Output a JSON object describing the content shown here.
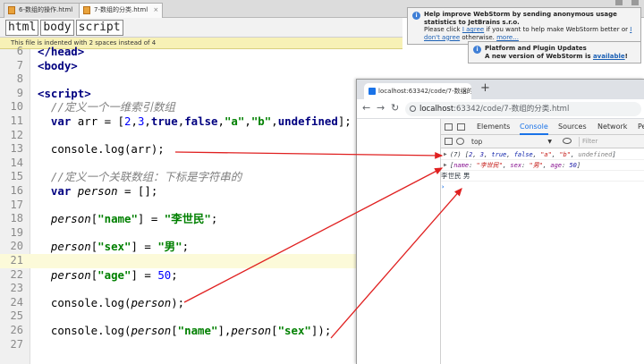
{
  "tabs": [
    {
      "label": "6-数组的操作.html",
      "active": false
    },
    {
      "label": "7-数组的分类.html",
      "active": true
    }
  ],
  "breadcrumb": [
    "html",
    "body",
    "script"
  ],
  "indent_warning": "This file is indented with 2 spaces instead of 4",
  "code_lines": [
    {
      "num": "6",
      "text": "</head>"
    },
    {
      "num": "7",
      "text": "<body>"
    },
    {
      "num": "8",
      "text": ""
    },
    {
      "num": "9",
      "text": "<script>"
    },
    {
      "num": "10",
      "text": "  //定义一个一维索引数组"
    },
    {
      "num": "11",
      "text": "  var arr = [2,3,true,false,\"a\",\"b\",undefined];"
    },
    {
      "num": "12",
      "text": ""
    },
    {
      "num": "13",
      "text": "  console.log(arr);"
    },
    {
      "num": "14",
      "text": ""
    },
    {
      "num": "15",
      "text": "  //定义一个关联数组：下标是字符串的"
    },
    {
      "num": "16",
      "text": "  var person = [];"
    },
    {
      "num": "17",
      "text": ""
    },
    {
      "num": "18",
      "text": "  person[\"name\"] = \"李世民\";"
    },
    {
      "num": "19",
      "text": ""
    },
    {
      "num": "20",
      "text": "  person[\"sex\"] = \"男\";"
    },
    {
      "num": "21",
      "text": ""
    },
    {
      "num": "22",
      "text": "  person[\"age\"] = 50;"
    },
    {
      "num": "23",
      "text": ""
    },
    {
      "num": "24",
      "text": "  console.log(person);"
    },
    {
      "num": "25",
      "text": ""
    },
    {
      "num": "26",
      "text": "  console.log(person[\"name\"],person[\"sex\"]);"
    },
    {
      "num": "27",
      "text": ""
    }
  ],
  "browser": {
    "tab_title": "localhost:63342/code/7-数组的",
    "url_host": "localhost",
    "url_path": ":63342/code/7-数组的分类.html"
  },
  "devtools": {
    "tabs": [
      "Elements",
      "Console",
      "Sources",
      "Network",
      "Pe"
    ],
    "active_tab": "Console",
    "context": "top",
    "filter_placeholder": "Filter",
    "output": {
      "line1_count": "(7)",
      "line2_keys": [
        "name",
        "sex",
        "age"
      ],
      "line2_vals": [
        "\"李世民\"",
        "\"男\"",
        "50"
      ],
      "line3": "李世民 男"
    }
  },
  "notifications": {
    "usage": {
      "title": "Help improve WebStorm by sending anonymous usage statistics to JetBrains s.r.o.",
      "body_pre": "Please click",
      "agree": "I agree",
      "body_mid": "if you want to help make WebStorm better or",
      "disagree": "I don't agree",
      "body_post": "otherwise.",
      "more": "more..."
    },
    "updates": {
      "title": "Platform and Plugin Updates",
      "body_pre": "A new version of WebStorm is",
      "available": "available",
      "body_post": "!"
    }
  },
  "colors": {
    "keyword": "#000080",
    "string": "#008000",
    "number": "#0000ff",
    "comment": "#808080",
    "arrow": "#e02020"
  }
}
